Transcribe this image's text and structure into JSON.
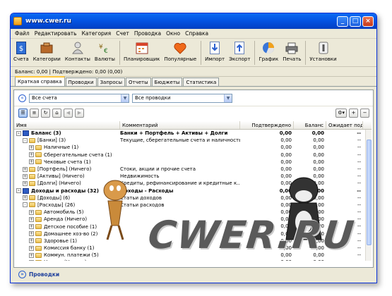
{
  "window": {
    "title": "www.cwer.ru"
  },
  "menu": [
    "Файл",
    "Редактировать",
    "Категория",
    "Счет",
    "Проводка",
    "Окно",
    "Справка"
  ],
  "toolbar": [
    {
      "label": "Счета",
      "icon": "accounts-icon"
    },
    {
      "label": "Категории",
      "icon": "categories-icon"
    },
    {
      "label": "Контакты",
      "icon": "contacts-icon"
    },
    {
      "label": "Валюты",
      "icon": "currencies-icon"
    },
    {
      "label": "Планировщик",
      "icon": "scheduler-icon"
    },
    {
      "label": "Популярные",
      "icon": "favorites-icon"
    },
    {
      "label": "Импорт",
      "icon": "import-icon"
    },
    {
      "label": "Экспорт",
      "icon": "export-icon"
    },
    {
      "label": "График",
      "icon": "chart-icon"
    },
    {
      "label": "Печать",
      "icon": "print-icon"
    },
    {
      "label": "Установки",
      "icon": "settings-icon"
    }
  ],
  "balance_line": "Баланс: 0,00 | Подтверждено: 0,00 (0,00)",
  "tabs": [
    "Краткая справка",
    "Проводки",
    "Запросы",
    "Отчеты",
    "Бюджеты",
    "Статистика"
  ],
  "filters": {
    "accounts": "Все счета",
    "transactions": "Все проводки"
  },
  "columns": {
    "name": "Имя",
    "comment": "Комментарий",
    "confirmed": "Подтверждено",
    "balance": "Баланс",
    "expected": "Ожидает подтв"
  },
  "rows": [
    {
      "level": 0,
      "toggle": "-",
      "icon": "book",
      "bold": true,
      "name": "Баланс (3)",
      "comment": "Банки + Портфель + Активы + Долги",
      "confirmed": "0,00",
      "balance": "0,00",
      "expected": "--"
    },
    {
      "level": 1,
      "toggle": "-",
      "icon": "folder",
      "bold": false,
      "name": "[Банки] (3)",
      "comment": "Текущие, сберегательные счета и наличность",
      "confirmed": "0,00",
      "balance": "0,00",
      "expected": "--"
    },
    {
      "level": 2,
      "toggle": "+",
      "icon": "folder",
      "bold": false,
      "name": "Наличные (1)",
      "comment": "",
      "confirmed": "0,00",
      "balance": "0,00",
      "expected": "--"
    },
    {
      "level": 2,
      "toggle": "+",
      "icon": "folder",
      "bold": false,
      "name": "Сберегательные счета (1)",
      "comment": "",
      "confirmed": "0,00",
      "balance": "0,00",
      "expected": "--"
    },
    {
      "level": 2,
      "toggle": "+",
      "icon": "folder",
      "bold": false,
      "name": "Чековые счета (1)",
      "comment": "",
      "confirmed": "0,00",
      "balance": "0,00",
      "expected": "--"
    },
    {
      "level": 1,
      "toggle": "+",
      "icon": "folder",
      "bold": false,
      "name": "[Портфель] (Ничего)",
      "comment": "Стоки, акции и прочие счета",
      "confirmed": "0,00",
      "balance": "0,00",
      "expected": "--"
    },
    {
      "level": 1,
      "toggle": "+",
      "icon": "folder",
      "bold": false,
      "name": "[Активы] (Ничего)",
      "comment": "Недвижимость",
      "confirmed": "0,00",
      "balance": "0,00",
      "expected": "--"
    },
    {
      "level": 1,
      "toggle": "+",
      "icon": "folder",
      "bold": false,
      "name": "[Долги] (Ничего)",
      "comment": "Кредиты, рефинансирование и кредитные к...",
      "confirmed": "0,00",
      "balance": "0,00",
      "expected": "--"
    },
    {
      "level": 0,
      "toggle": "-",
      "icon": "book",
      "bold": true,
      "name": "Доходы и расходы (32)",
      "comment": "Доходы - Расходы",
      "confirmed": "0,00",
      "balance": "0,00",
      "expected": "--"
    },
    {
      "level": 1,
      "toggle": "+",
      "icon": "folder",
      "bold": false,
      "name": "[Доходы] (6)",
      "comment": "Статьи доходов",
      "confirmed": "0,00",
      "balance": "0,00",
      "expected": "--"
    },
    {
      "level": 1,
      "toggle": "-",
      "icon": "folder",
      "bold": false,
      "name": "[Расходы] (26)",
      "comment": "Статьи расходов",
      "confirmed": "0,00",
      "balance": "0,00",
      "expected": "--"
    },
    {
      "level": 2,
      "toggle": "+",
      "icon": "folder",
      "bold": false,
      "name": "Автомобиль (5)",
      "comment": "",
      "confirmed": "0,00",
      "balance": "0,00",
      "expected": "--"
    },
    {
      "level": 2,
      "toggle": "+",
      "icon": "folder",
      "bold": false,
      "name": "Аренда (Ничего)",
      "comment": "",
      "confirmed": "0,00",
      "balance": "0,00",
      "expected": "--"
    },
    {
      "level": 2,
      "toggle": "+",
      "icon": "folder",
      "bold": false,
      "name": "Детское пособие (1)",
      "comment": "",
      "confirmed": "0,00",
      "balance": "0,00",
      "expected": "--"
    },
    {
      "level": 2,
      "toggle": "+",
      "icon": "folder",
      "bold": false,
      "name": "Домашнее хоз-во (2)",
      "comment": "",
      "confirmed": "0,00",
      "balance": "0,00",
      "expected": "--"
    },
    {
      "level": 2,
      "toggle": "+",
      "icon": "folder",
      "bold": false,
      "name": "Здоровье (1)",
      "comment": "",
      "confirmed": "0,00",
      "balance": "0,00",
      "expected": "--"
    },
    {
      "level": 2,
      "toggle": "+",
      "icon": "folder",
      "bold": false,
      "name": "Комиссия банку (1)",
      "comment": "",
      "confirmed": "0,00",
      "balance": "0,00",
      "expected": "--"
    },
    {
      "level": 2,
      "toggle": "+",
      "icon": "folder",
      "bold": false,
      "name": "Коммун. платежи (5)",
      "comment": "",
      "confirmed": "0,00",
      "balance": "0,00",
      "expected": "--"
    },
    {
      "level": 2,
      "toggle": "+",
      "icon": "folder",
      "bold": false,
      "name": "Налоги (Ничего)",
      "comment": "",
      "confirmed": "0,00",
      "balance": "0,00",
      "expected": "--"
    }
  ],
  "bottom": {
    "label": "Проводки"
  },
  "watermark": {
    "text": "CWER.RU"
  }
}
